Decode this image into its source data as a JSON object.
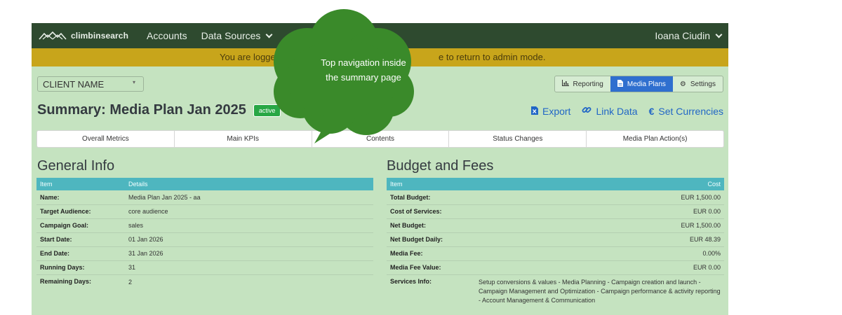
{
  "navbar": {
    "brand": "climbinsearch",
    "links": [
      "Accounts",
      "Data Sources"
    ],
    "user": "Ioana Ciudin"
  },
  "banner": {
    "text_left": "You are logged i",
    "text_right": "e to return to admin mode."
  },
  "client_select": {
    "value": "CLIENT NAME"
  },
  "page": {
    "title": "Summary: Media Plan Jan 2025",
    "status": "active"
  },
  "toolbar": {
    "reporting": "Reporting",
    "media_plans": "Media Plans",
    "settings": "Settings"
  },
  "actions": {
    "export": "Export",
    "link_data": "Link Data",
    "set_currencies": "Set Currencies"
  },
  "tabs": [
    "Overall Metrics",
    "Main KPIs",
    "Contents",
    "Status Changes",
    "Media Plan Action(s)"
  ],
  "general_info": {
    "title": "General Info",
    "headers": [
      "Item",
      "Details"
    ],
    "rows": [
      {
        "k": "Name:",
        "v": "Media Plan Jan 2025 - aa"
      },
      {
        "k": "Target Audience:",
        "v": "core audience"
      },
      {
        "k": "Campaign Goal:",
        "v": "sales"
      },
      {
        "k": "Start Date:",
        "v": "01 Jan 2026"
      },
      {
        "k": "End Date:",
        "v": "31 Jan 2026"
      },
      {
        "k": "Running Days:",
        "v": "31"
      },
      {
        "k": "Remaining Days:",
        "v": "2"
      }
    ]
  },
  "budget": {
    "title": "Budget and Fees",
    "headers": [
      "Item",
      "Cost"
    ],
    "rows": [
      {
        "k": "Total Budget:",
        "v": "EUR 1,500.00"
      },
      {
        "k": "Cost of Services:",
        "v": "EUR 0.00"
      },
      {
        "k": "Net Budget:",
        "v": "EUR 1,500.00"
      },
      {
        "k": "Net Budget Daily:",
        "v": "EUR 48.39"
      },
      {
        "k": "Media Fee:",
        "v": "0.00%"
      },
      {
        "k": "Media Fee Value:",
        "v": "EUR 0.00"
      }
    ],
    "services_label": "Services Info:",
    "services_text": "Setup conversions & values - Media Planning - Campaign creation and launch - Campaign Management and Optimization - Campaign performance & activity reporting - Account Management & Communication"
  },
  "callout": {
    "line1": "Top navigation inside",
    "line2": "the summary page",
    "color": "#3a8a2a"
  }
}
